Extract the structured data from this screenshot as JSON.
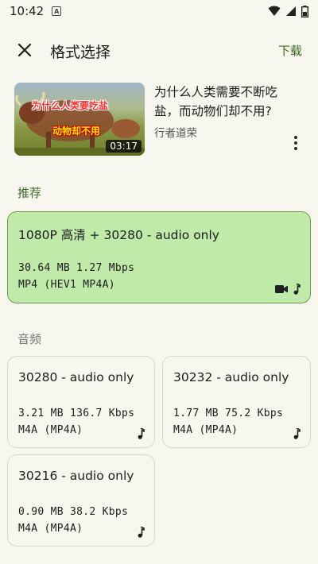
{
  "status_bar": {
    "time": "10:42",
    "notification_icon": "a-icon"
  },
  "top_bar": {
    "title": "格式选择",
    "download_label": "下载"
  },
  "video": {
    "thumbnail_text_1": "为什么人类要吃盐",
    "thumbnail_text_2": "动物却不用",
    "duration": "03:17",
    "title": "为什么人类需要不断吃盐，而动物们却不用?",
    "author": "行者道荣"
  },
  "sections": {
    "recommended": "推荐",
    "audio": "音频"
  },
  "recommended_format": {
    "title": "1080P 高清 + 30280 - audio only",
    "size_bitrate": "30.64 MB 1.27 Mbps",
    "container": "MP4 (HEV1 MP4A)"
  },
  "audio_formats": [
    {
      "title": "30280 - audio only",
      "size_bitrate": "3.21 MB 136.7 Kbps",
      "container": "M4A (MP4A)"
    },
    {
      "title": "30232 - audio only",
      "size_bitrate": "1.77 MB 75.2 Kbps",
      "container": "M4A (MP4A)"
    },
    {
      "title": "30216 - audio only",
      "size_bitrate": "0.90 MB 38.2 Kbps",
      "container": "M4A (MP4A)"
    }
  ],
  "colors": {
    "background": "#f8f7ef",
    "accent": "#3b6b1f",
    "selected_card": "#bfeaa9"
  }
}
